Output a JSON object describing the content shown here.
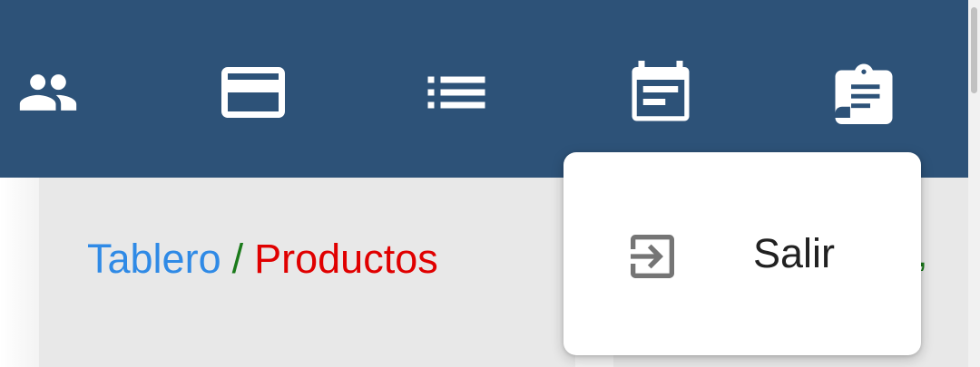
{
  "colors": {
    "topbar": "#2d5278",
    "icon": "#ffffff",
    "breadcrumb_home": "#2f8ae6",
    "breadcrumb_separator": "#1a7a1a",
    "breadcrumb_current": "#e00000",
    "menu_icon": "#757575"
  },
  "nav": {
    "items": [
      {
        "icon": "people-icon"
      },
      {
        "icon": "credit-card-icon"
      },
      {
        "icon": "list-icon"
      },
      {
        "icon": "calendar-event-icon"
      },
      {
        "icon": "assignment-badge-icon"
      }
    ]
  },
  "breadcrumb": {
    "home": "Tablero",
    "separator": "/",
    "current": "Productos"
  },
  "menu": {
    "items": [
      {
        "icon": "exit-to-app-icon",
        "label": "Salir"
      }
    ]
  }
}
